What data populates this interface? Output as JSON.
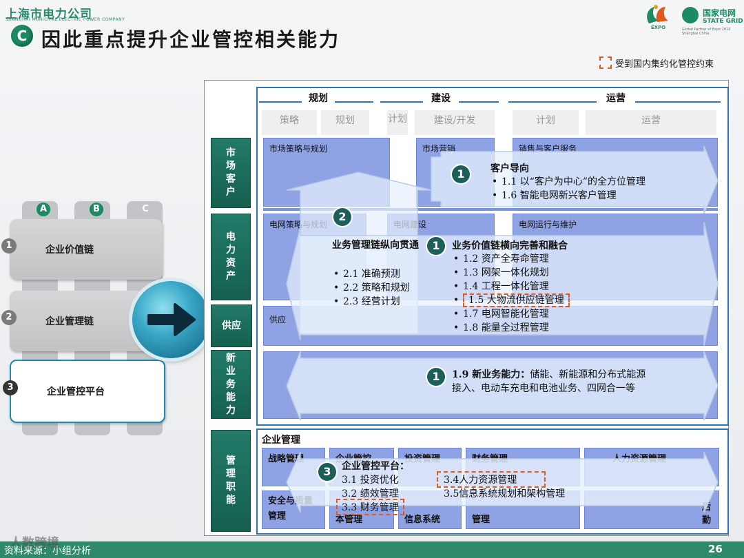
{
  "header": {
    "company_cn": "上海市电力公司",
    "company_en": "SHANGHAI MUNICIPAL ELECTRIC POWER COMPANY",
    "badge": "C",
    "title": "因此重点提升企业管控相关能力",
    "expo": "EXPO",
    "sg_cn": "国家电网",
    "sg_en": "STATE GRID",
    "sg_small": "Global Partner of Expo 2010 Shanghai China",
    "legend": "受到国内集约化管控约束"
  },
  "left": {
    "tabs": [
      {
        "label": "A",
        "color": "#1c8a62"
      },
      {
        "label": "B",
        "color": "#1c8a62"
      },
      {
        "label": "C",
        "color": "#b0b0b0"
      }
    ],
    "cards": [
      {
        "num": "1",
        "label": "企业价值链"
      },
      {
        "num": "2",
        "label": "企业管理链"
      },
      {
        "num": "3",
        "label": "企业管控平台"
      }
    ]
  },
  "columns": [
    {
      "title": "规划",
      "subs": [
        "策略",
        "规划"
      ]
    },
    {
      "title": "建设",
      "subs": [
        "计划",
        "建设/开发"
      ]
    },
    {
      "title": "运营",
      "subs": [
        "计划",
        "运营"
      ]
    }
  ],
  "rows": [
    {
      "label": "市场客户"
    },
    {
      "label": "电力资产"
    },
    {
      "label": "供应"
    },
    {
      "label": "新业务能力"
    },
    {
      "label": "管理职能"
    }
  ],
  "cells": {
    "r1c1": "市场策略与规划",
    "r1c2": "市场营销",
    "r1c3": "销售与客户服务",
    "r2c1": "电网策略与规划",
    "r2c2": "电网建设",
    "r2c3": "电网运行与维护",
    "r3c1": "供应"
  },
  "bottom": {
    "title": "企业管理",
    "row1": [
      "战略管理",
      "企业管控",
      "投资管理",
      "财务管理",
      "人力资源管理"
    ],
    "row2": [
      "安全与质量管理",
      "本管理",
      "信息系统",
      "管理",
      "后勤"
    ]
  },
  "callouts": {
    "c1": {
      "num": "1",
      "title": "客户导向",
      "items": [
        "1.1 以“客户为中心”的全方位管理",
        "1.6 智能电网新兴客户管理"
      ]
    },
    "c2": {
      "num": "2",
      "title": "业务管理链纵向贯通",
      "items": [
        "2.1 准确预测",
        "2.2 策略和规划",
        "2.3 经营计划"
      ]
    },
    "c1b": {
      "num": "1",
      "title": "业务价值链横向完善和融合",
      "items": [
        "1.2 资产全寿命管理",
        "1.3 网架一体化规划",
        "1.4 工程一体化管理",
        "1.5 大物流供应链管理",
        "1.7 电网智能化管理",
        "1.8 能量全过程管理"
      ]
    },
    "c19": {
      "num": "1",
      "title": "1.9 新业务能力：",
      "text": "储能、新能源和分布式能源接入、电动车充电和电池业务、四网合一等"
    },
    "c3": {
      "num": "3",
      "title": "企业管控平台：",
      "items": [
        "3.1 投资优化",
        "3.2 绩效管理",
        "3.3 财务管理",
        "3.4人力资源管理",
        "3.5信息系统规划和架构管理"
      ]
    }
  },
  "footer": {
    "source": "资料来源：小组分析",
    "page": "26",
    "watermark": "人数跨境"
  }
}
